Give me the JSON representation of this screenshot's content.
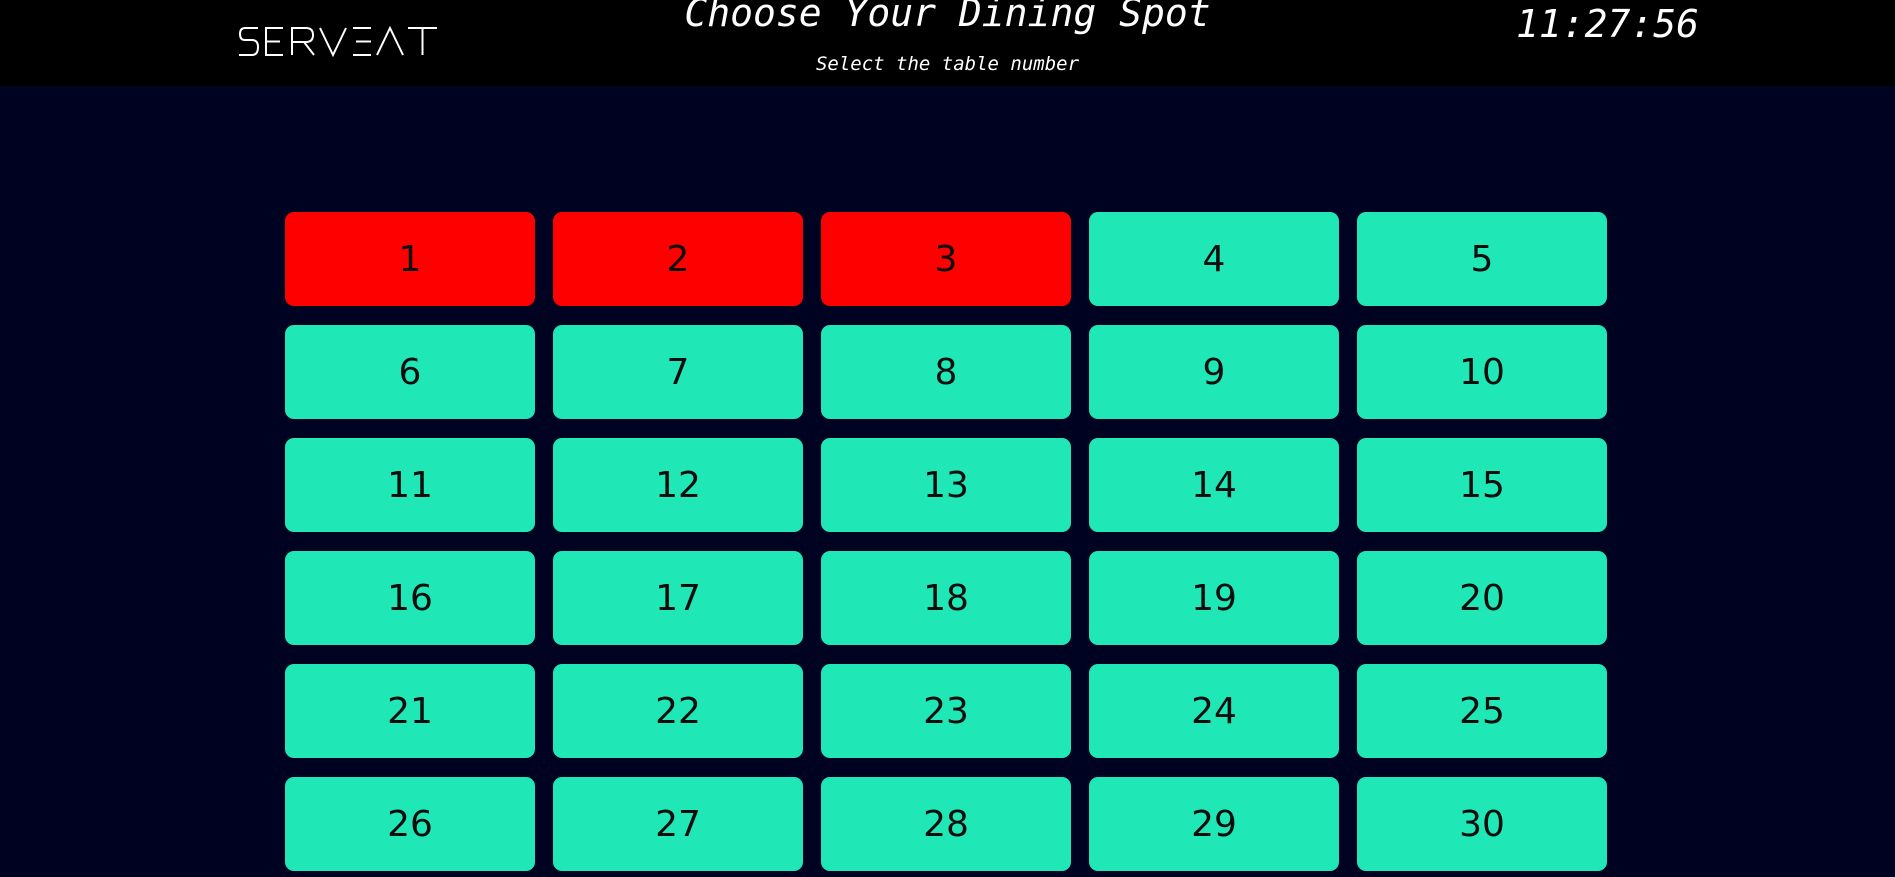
{
  "header": {
    "logo_text": "SERVEAT",
    "title": "Choose Your Dining Spot",
    "subtitle": "Select the table number",
    "clock": "11:27:56"
  },
  "colors": {
    "background": "#000222",
    "topbar": "#000000",
    "available": "#1fe8b6",
    "occupied": "#ff0000"
  },
  "tables": [
    {
      "number": "1",
      "status": "occupied"
    },
    {
      "number": "2",
      "status": "occupied"
    },
    {
      "number": "3",
      "status": "occupied"
    },
    {
      "number": "4",
      "status": "available"
    },
    {
      "number": "5",
      "status": "available"
    },
    {
      "number": "6",
      "status": "available"
    },
    {
      "number": "7",
      "status": "available"
    },
    {
      "number": "8",
      "status": "available"
    },
    {
      "number": "9",
      "status": "available"
    },
    {
      "number": "10",
      "status": "available"
    },
    {
      "number": "11",
      "status": "available"
    },
    {
      "number": "12",
      "status": "available"
    },
    {
      "number": "13",
      "status": "available"
    },
    {
      "number": "14",
      "status": "available"
    },
    {
      "number": "15",
      "status": "available"
    },
    {
      "number": "16",
      "status": "available"
    },
    {
      "number": "17",
      "status": "available"
    },
    {
      "number": "18",
      "status": "available"
    },
    {
      "number": "19",
      "status": "available"
    },
    {
      "number": "20",
      "status": "available"
    },
    {
      "number": "21",
      "status": "available"
    },
    {
      "number": "22",
      "status": "available"
    },
    {
      "number": "23",
      "status": "available"
    },
    {
      "number": "24",
      "status": "available"
    },
    {
      "number": "25",
      "status": "available"
    },
    {
      "number": "26",
      "status": "available"
    },
    {
      "number": "27",
      "status": "available"
    },
    {
      "number": "28",
      "status": "available"
    },
    {
      "number": "29",
      "status": "available"
    },
    {
      "number": "30",
      "status": "available"
    }
  ]
}
